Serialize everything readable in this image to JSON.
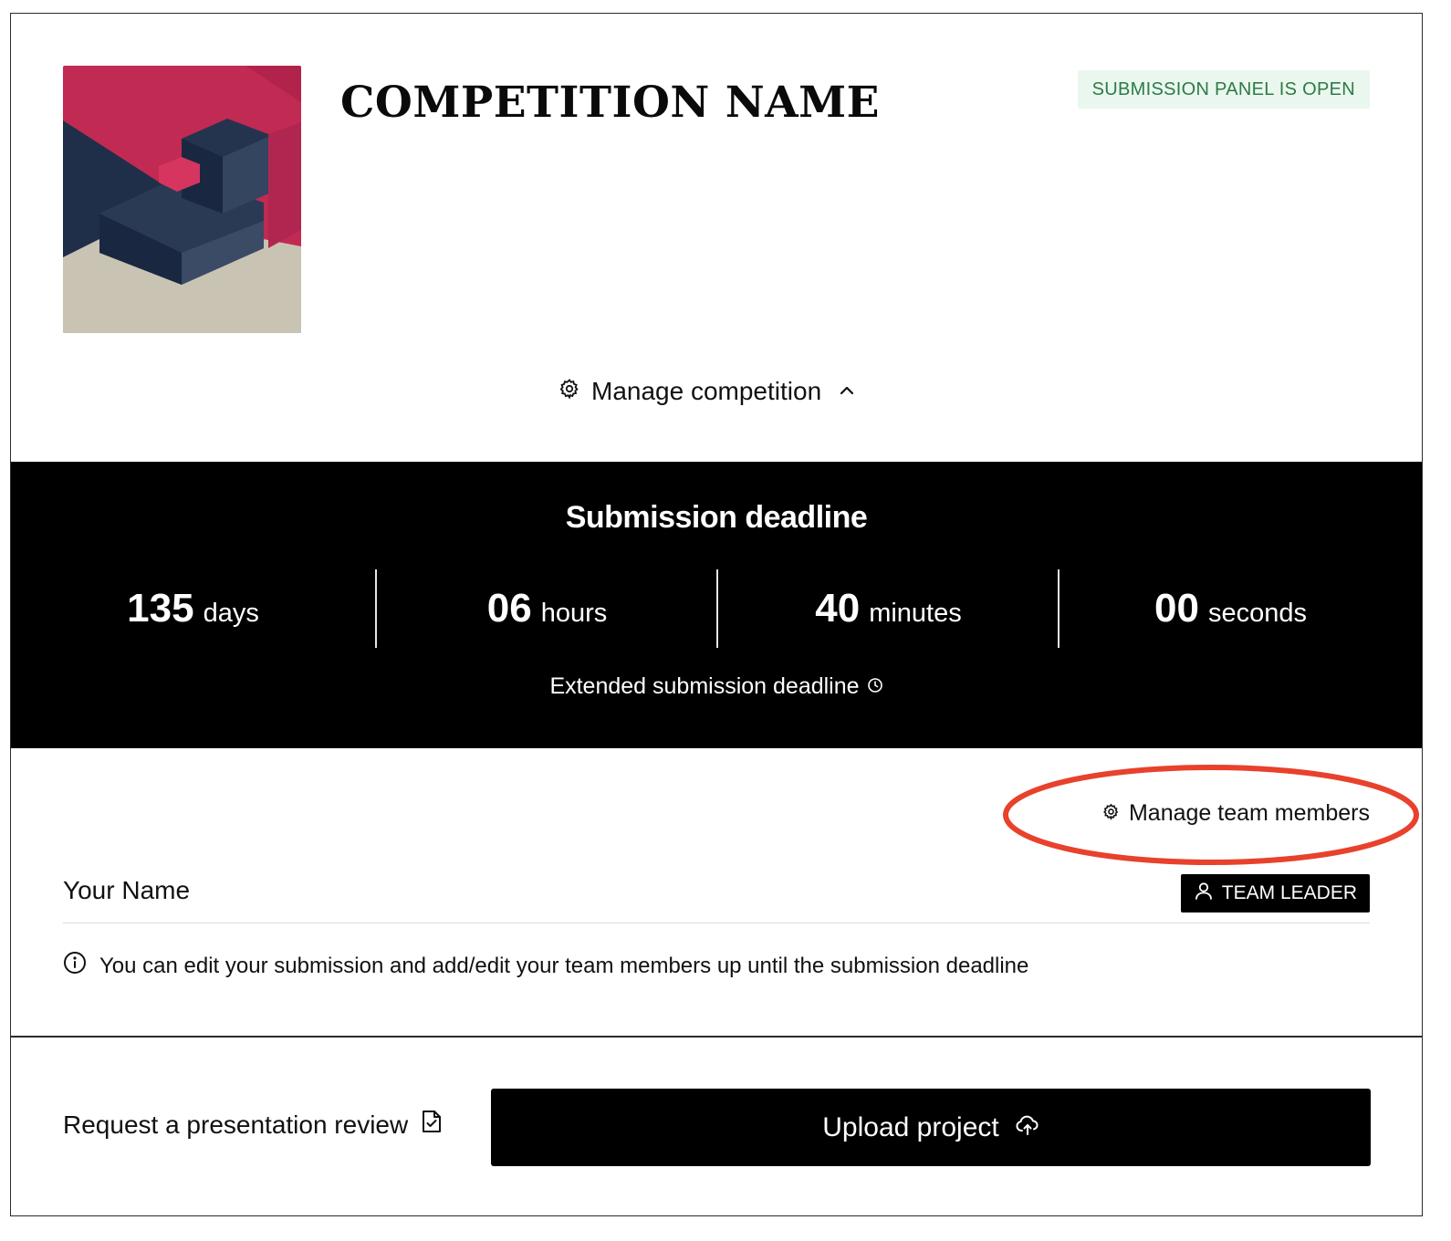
{
  "header": {
    "title": "COMPETITION NAME",
    "status_badge": "SUBMISSION PANEL IS OPEN",
    "manage_competition": "Manage competition"
  },
  "deadline": {
    "title": "Submission deadline",
    "days": {
      "value": "135",
      "label": "days"
    },
    "hours": {
      "value": "06",
      "label": "hours"
    },
    "minutes": {
      "value": "40",
      "label": "minutes"
    },
    "seconds": {
      "value": "00",
      "label": "seconds"
    },
    "extended_label": "Extended submission deadline"
  },
  "team": {
    "manage_label": "Manage team members",
    "member_name": "Your Name",
    "role_badge": "TEAM LEADER",
    "info_note": "You can edit your submission and add/edit your team members up until the submission deadline"
  },
  "actions": {
    "review_label": "Request a presentation review",
    "upload_label": "Upload project"
  },
  "colors": {
    "status_bg": "#eaf7ee",
    "status_text": "#2e7a47",
    "annotation": "#e8412c",
    "cover_pink": "#c12a52",
    "cover_navy": "#1f2f4a",
    "cover_beige": "#c9c3b3"
  },
  "icons": {
    "manage_competition": "gear-icon",
    "manage_competition_toggle": "chevron-up-icon",
    "extended_deadline": "clock-icon",
    "manage_team": "gear-icon",
    "role": "user-icon",
    "info": "info-icon",
    "review": "document-check-icon",
    "upload": "cloud-upload-icon"
  }
}
